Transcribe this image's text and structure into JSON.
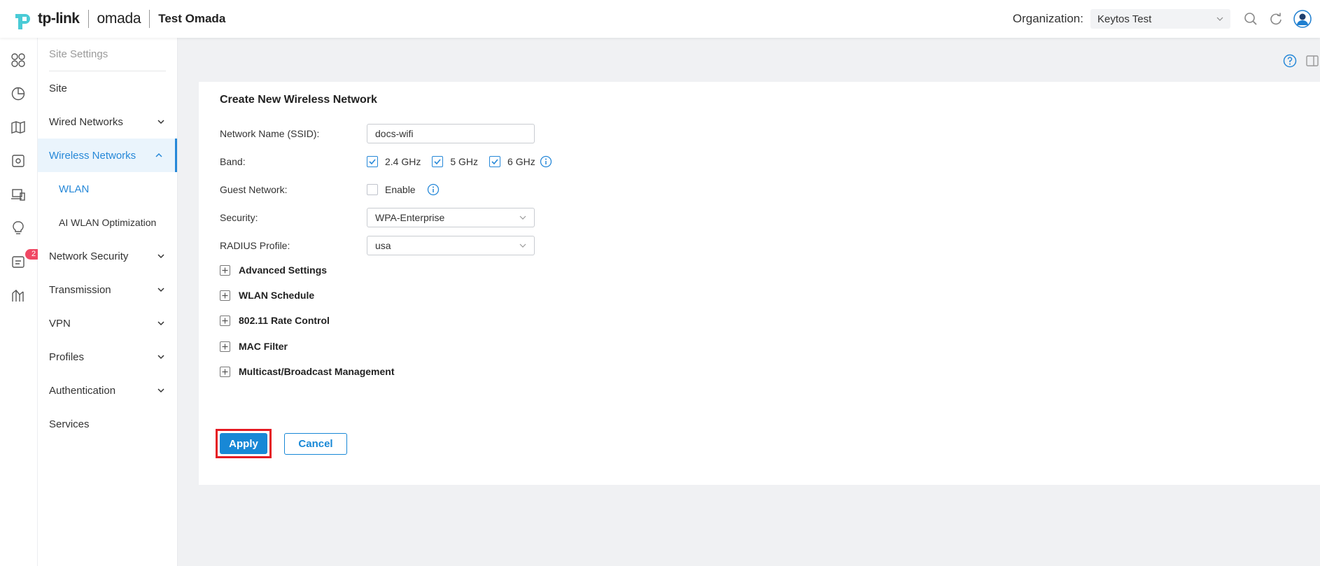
{
  "header": {
    "brand": "tp-link",
    "product": "omada",
    "site_title": "Test Omada",
    "org_label": "Organization:",
    "org_value": "Keytos Test"
  },
  "rail": {
    "icons": [
      "dashboard-icon",
      "statistics-icon",
      "map-icon",
      "devices-icon",
      "clients-icon",
      "insights-icon",
      "logs-icon",
      "reports-icon"
    ],
    "logs_badge": "2"
  },
  "menu": {
    "heading": "Site Settings",
    "items": [
      {
        "label": "Site"
      },
      {
        "label": "Wired Networks"
      },
      {
        "label": "Wireless Networks"
      },
      {
        "label": "WLAN"
      },
      {
        "label": "AI WLAN Optimization"
      },
      {
        "label": "Network Security"
      },
      {
        "label": "Transmission"
      },
      {
        "label": "VPN"
      },
      {
        "label": "Profiles"
      },
      {
        "label": "Authentication"
      },
      {
        "label": "Services"
      }
    ]
  },
  "form": {
    "title": "Create New Wireless Network",
    "ssid_label": "Network Name (SSID):",
    "ssid_value": "docs-wifi",
    "band_label": "Band:",
    "bands": [
      {
        "label": "2.4 GHz",
        "checked": true
      },
      {
        "label": "5 GHz",
        "checked": true
      },
      {
        "label": "6 GHz",
        "checked": true
      }
    ],
    "guest_label": "Guest Network:",
    "guest_enable_label": "Enable",
    "guest_checked": false,
    "security_label": "Security:",
    "security_value": "WPA-Enterprise",
    "radius_label": "RADIUS Profile:",
    "radius_value": "usa",
    "sections": [
      "Advanced Settings",
      "WLAN Schedule",
      "802.11 Rate Control",
      "MAC Filter",
      "Multicast/Broadcast Management"
    ],
    "apply_label": "Apply",
    "cancel_label": "Cancel"
  },
  "colors": {
    "accent": "#2688d8",
    "button_primary": "#1888d6",
    "highlight_box": "#e51b24",
    "badge": "#f04864"
  }
}
